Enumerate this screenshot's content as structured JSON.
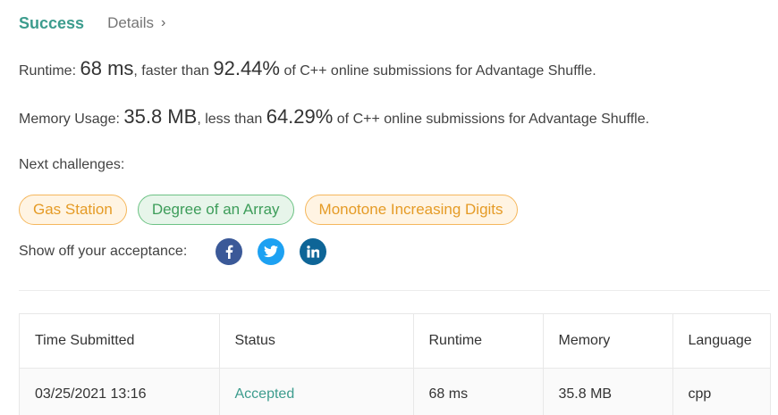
{
  "tabs": {
    "success": "Success",
    "details": "Details",
    "details_chevron": "›"
  },
  "runtime": {
    "label": "Runtime:",
    "value": "68 ms",
    "middle": ", faster than",
    "percent": "92.44%",
    "suffix": "of C++ online submissions for Advantage Shuffle."
  },
  "memory": {
    "label": "Memory Usage:",
    "value": "35.8 MB",
    "middle": ", less than",
    "percent": "64.29%",
    "suffix": "of C++ online submissions for Advantage Shuffle."
  },
  "next_challenges": {
    "label": "Next challenges:",
    "items": [
      {
        "label": "Gas Station",
        "difficulty": "medium"
      },
      {
        "label": "Degree of an Array",
        "difficulty": "easy"
      },
      {
        "label": "Monotone Increasing Digits",
        "difficulty": "medium"
      }
    ]
  },
  "share": {
    "label": "Show off your acceptance:",
    "icons": [
      "facebook-icon",
      "twitter-icon",
      "linkedin-icon"
    ]
  },
  "colors": {
    "success": "#3c9c8d",
    "medium_chip": "#e59b26",
    "easy_chip": "#3d9d5a",
    "facebook": "#3b5998",
    "twitter": "#1da1f2",
    "linkedin": "#0e6597"
  },
  "table": {
    "headers": [
      "Time Submitted",
      "Status",
      "Runtime",
      "Memory",
      "Language"
    ],
    "rows": [
      {
        "time": "03/25/2021 13:16",
        "status": "Accepted",
        "runtime": "68 ms",
        "memory": "35.8 MB",
        "language": "cpp"
      }
    ]
  }
}
